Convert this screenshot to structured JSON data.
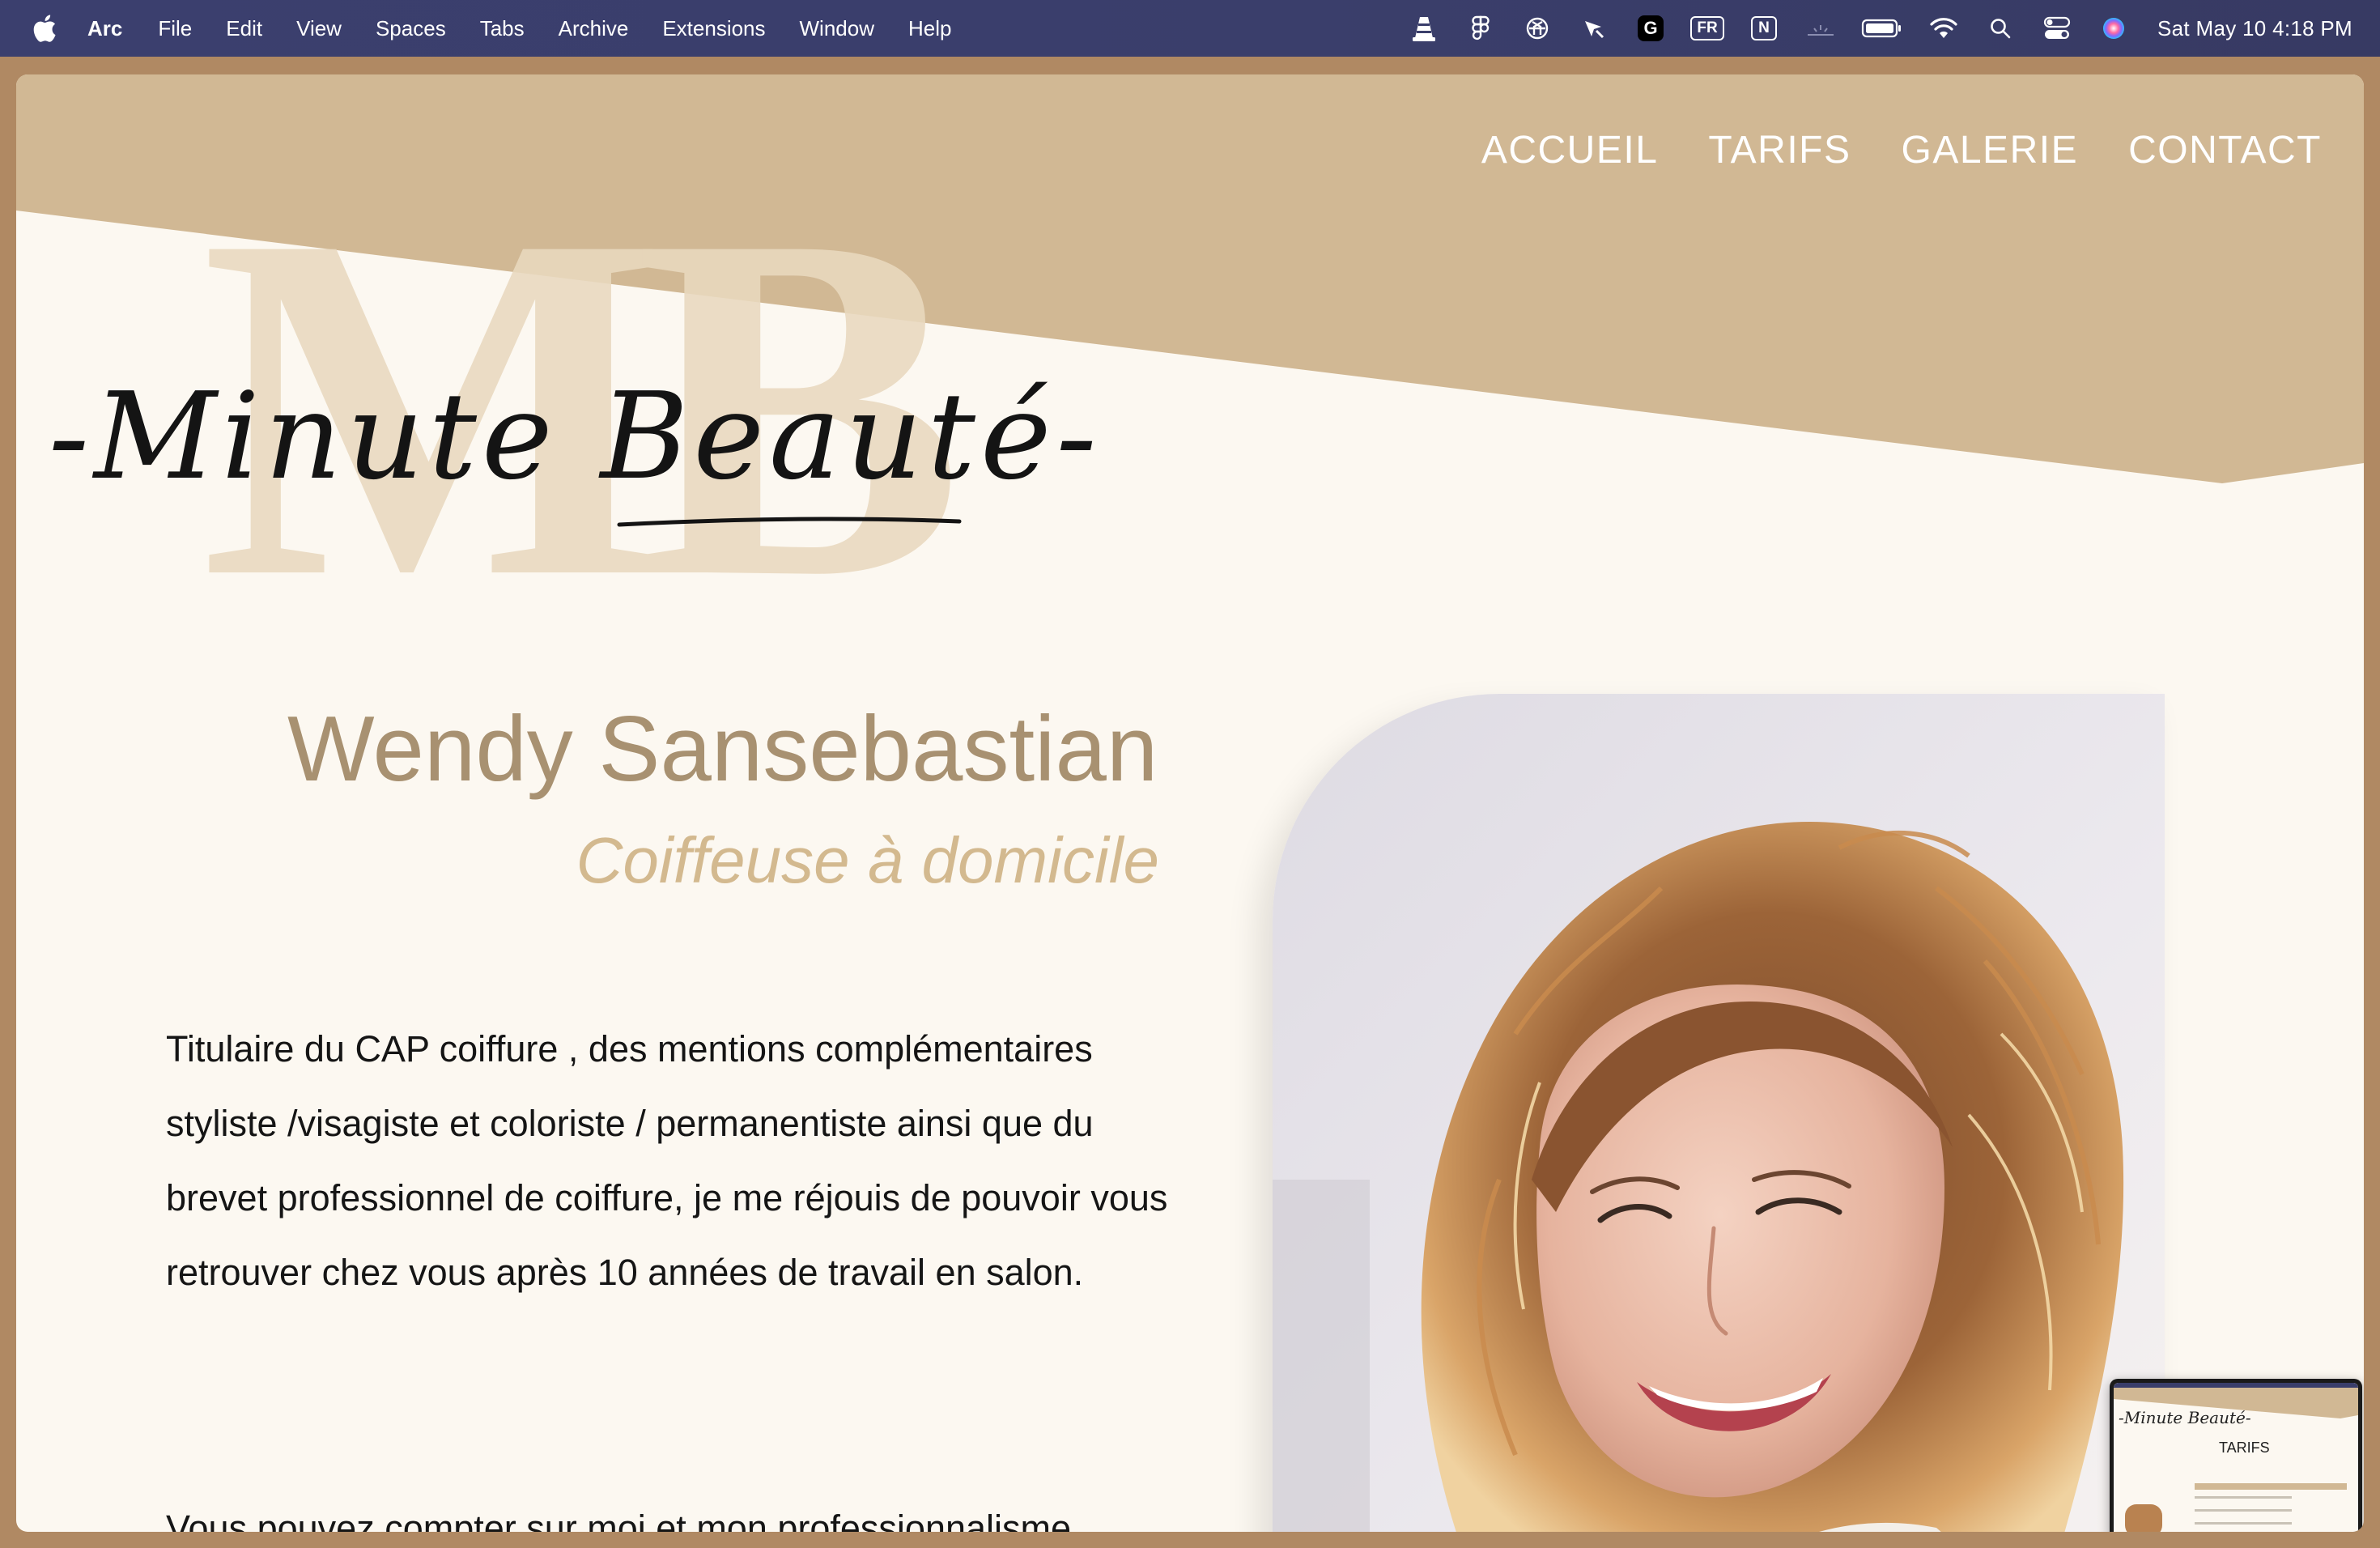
{
  "menubar": {
    "app_name": "Arc",
    "items": [
      "File",
      "Edit",
      "View",
      "Spaces",
      "Tabs",
      "Archive",
      "Extensions",
      "Window",
      "Help"
    ],
    "tray": {
      "input_source": "FR",
      "notion_letter": "N",
      "grammarly_letter": "G",
      "clock": "Sat May 10  4:18 PM"
    }
  },
  "site": {
    "logo_monogram": "MB",
    "logo_script": "-Minute Beauté-",
    "nav": [
      "ACCUEIL",
      "TARIFS",
      "GALERIE",
      "CONTACT"
    ],
    "name": "Wendy Sansebastian",
    "subtitle": "Coiffeuse à domicile",
    "bio": "Titulaire du CAP coiffure , des mentions complémentaires styliste /visagiste et coloriste / permanentiste ainsi que du brevet professionnel de coiffure, je me réjouis de pouvoir vous retrouver chez vous après 10 années de travail en salon.",
    "bio_2": "Vous pouvez compter sur moi et mon professionnalisme",
    "portrait_alt": "portrait"
  },
  "preview": {
    "title": "TARIFS"
  },
  "colors": {
    "header_tan": "#d1b894",
    "page_cream": "#fcf8f1",
    "name_color": "#a89171",
    "subtitle_color": "#d3b98f",
    "frame": "#b08963"
  }
}
